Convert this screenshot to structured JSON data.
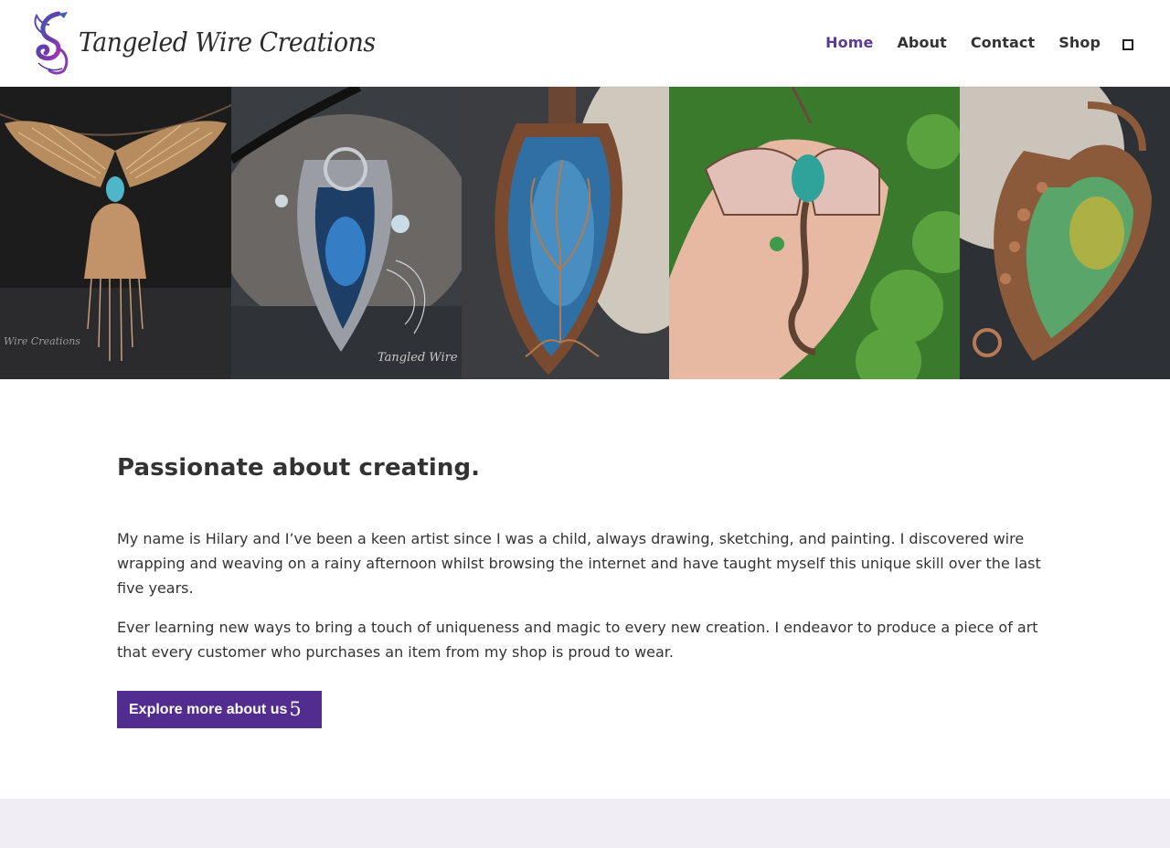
{
  "brand": {
    "name": "Tangeled Wire Creations"
  },
  "nav": {
    "items": [
      {
        "label": "Home",
        "active": true
      },
      {
        "label": "About",
        "active": false
      },
      {
        "label": "Contact",
        "active": false
      },
      {
        "label": "Shop",
        "active": false
      }
    ],
    "cart_icon": "cart-square-icon"
  },
  "hero": {
    "tiles": [
      {
        "subject": "phoenix-pendant"
      },
      {
        "subject": "silver-labradorite-pendant"
      },
      {
        "subject": "tree-of-life-pendant"
      },
      {
        "subject": "dragon-pendant-in-hand"
      },
      {
        "subject": "copper-heart-pendant"
      }
    ],
    "watermarks": [
      "Wire Creations",
      "Tangled Wire"
    ]
  },
  "about": {
    "heading": "Passionate about creating.",
    "paragraph_1": "My name is Hilary and I’ve been a keen artist since I was a child, always drawing, sketching, and painting. I discovered wire wrapping and weaving on a rainy afternoon whilst browsing the internet and have taught myself this unique skill over the last five years.",
    "paragraph_2": "Ever learning new ways to bring a touch of uniqueness and magic to every new creation. I endeavor to produce a piece of art that every customer who purchases an item from my shop is proud to wear.",
    "cta_label": "Explore more about us",
    "cta_arrow": "5"
  },
  "colors": {
    "accent": "#522c8f",
    "nav_active": "#5b3a93",
    "text": "#333333",
    "footer_band": "#f0eef4"
  }
}
